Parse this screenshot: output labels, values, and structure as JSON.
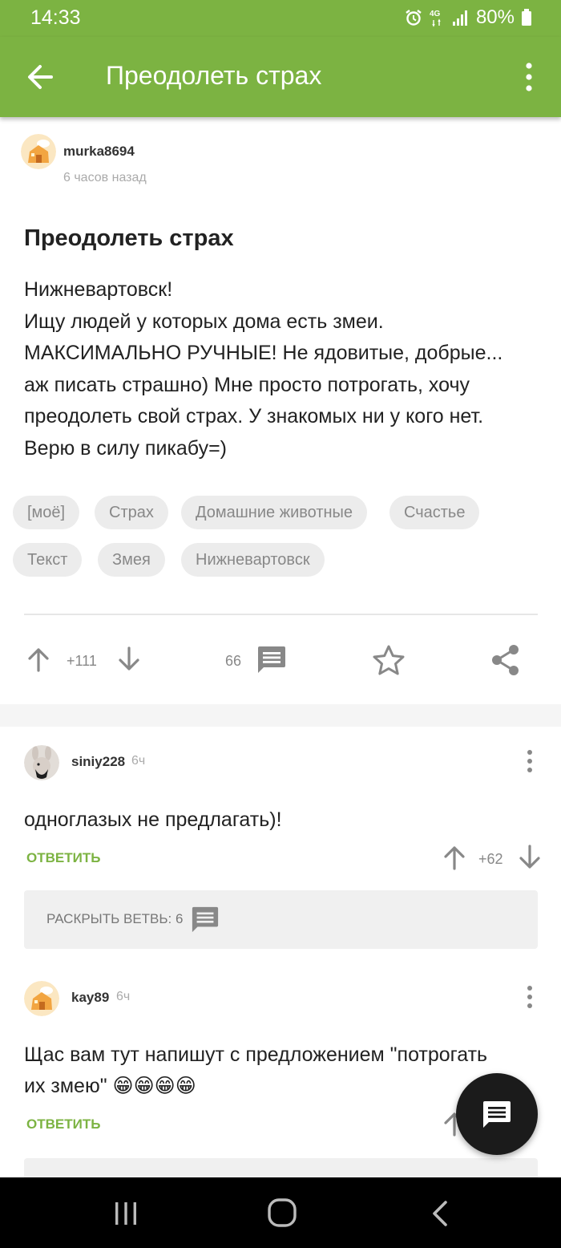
{
  "status_bar": {
    "time": "14:33",
    "network": "4G",
    "battery": "80%",
    "icons": [
      "alarm-icon",
      "network-4g-icon",
      "signal-icon",
      "battery-icon"
    ]
  },
  "app_bar": {
    "title": "Преодолеть страх",
    "icons": [
      "back-arrow-icon",
      "more-vert-icon"
    ]
  },
  "post": {
    "author": "murka8694",
    "time": "6 часов назад",
    "title": "Преодолеть страх",
    "body_lines": [
      "Нижневартовск!",
      "Ищу людей у которых дома есть змеи.",
      "МАКСИМАЛЬНО РУЧНЫЕ! Не ядовитые, добрые...",
      "аж писать страшно) Мне просто потрогать, хочу",
      "преодолеть свой страх. У знакомых ни у кого нет.",
      "Верю в силу пикабу=)"
    ],
    "tags": [
      "[моё]",
      "Страх",
      "Домашние животные",
      "Счастье",
      "Текст",
      "Змея",
      "Нижневартовск"
    ],
    "rating": "+111",
    "comments_count": "66",
    "action_icons": [
      "upvote-arrow-icon",
      "downvote-arrow-icon",
      "comments-icon",
      "star-icon",
      "share-icon"
    ]
  },
  "comments": [
    {
      "author": "siniy228",
      "time": "6ч",
      "text_lines": [
        "одноглазых не предлагать)!"
      ],
      "reply_label": "ОТВЕТИТЬ",
      "rating": "+62",
      "expand_label": "РАСКРЫТЬ ВЕТВЬ: 6"
    },
    {
      "author": "kay89",
      "time": "6ч",
      "text_lines": [
        "Щас вам тут напишут с предложением \"потрогать",
        "их змею\" 😁😁😁😁"
      ],
      "reply_label": "ОТВЕТИТЬ"
    }
  ],
  "fab": {
    "icon": "comment-icon"
  },
  "nav_bar": {
    "icons": [
      "recent-apps-icon",
      "home-icon",
      "back-icon"
    ]
  },
  "colors": {
    "brand_green": "#7cb342",
    "text_dark": "#222222",
    "text_muted": "#aaaaaa",
    "tag_background": "#ececec",
    "fab_background": "#1b1b1b",
    "nav_background": "#000000"
  }
}
